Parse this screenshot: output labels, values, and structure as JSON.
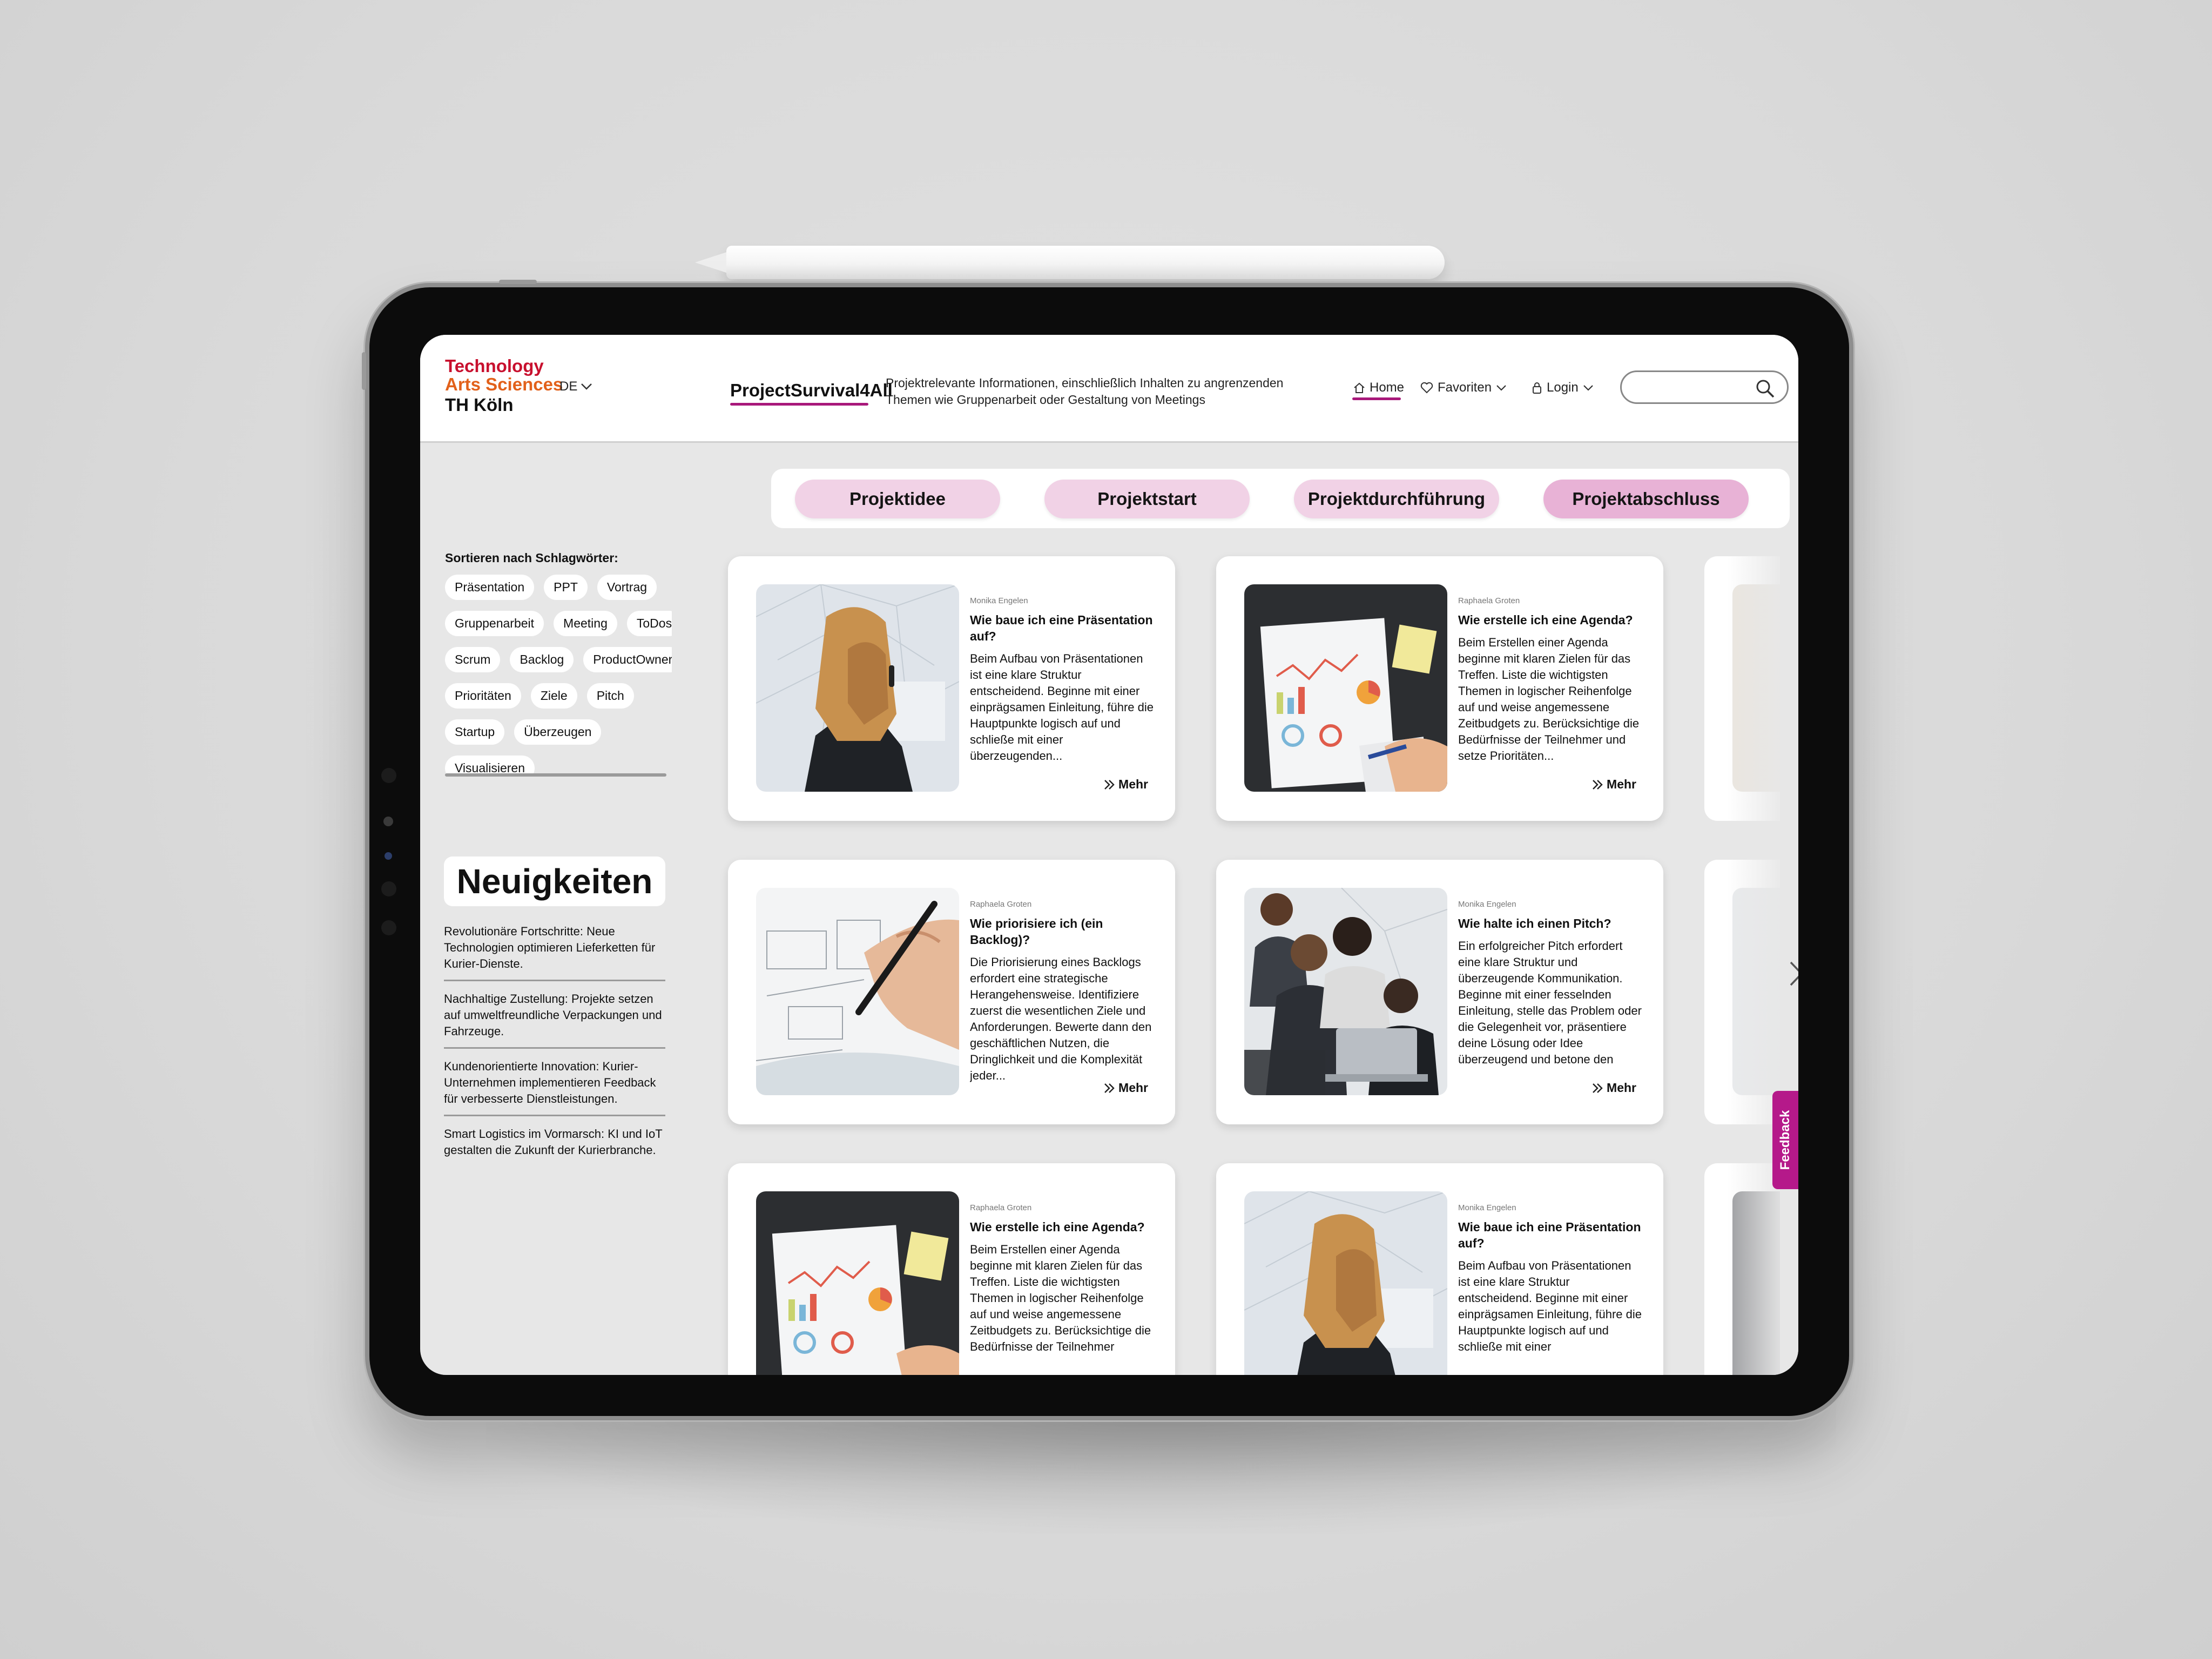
{
  "header": {
    "logo": {
      "line1": "Technology",
      "line2": "Arts Sciences",
      "line3": "TH Köln"
    },
    "language": "DE",
    "brand": "ProjectSurvival4All",
    "tagline": "Projektrelevante Informationen, einschließlich Inhalten zu angrenzenden Themen wie Gruppenarbeit oder Gestaltung von Meetings",
    "nav": {
      "home": "Home",
      "favorites": "Favoriten",
      "login": "Login"
    },
    "search_placeholder": ""
  },
  "phase_tabs": [
    {
      "label": "Projektidee"
    },
    {
      "label": "Projektstart"
    },
    {
      "label": "Projektdurchführung"
    },
    {
      "label": "Projektabschluss",
      "active": true
    }
  ],
  "sidebar": {
    "sort_label": "Sortieren nach Schlagwörter:",
    "tags": [
      "Präsentation",
      "PPT",
      "Vortrag",
      "Gruppenarbeit",
      "Meeting",
      "ToDos",
      "Scrum",
      "Backlog",
      "ProductOwner",
      "Prioritäten",
      "Ziele",
      "Pitch",
      "Startup",
      "Überzeugen",
      "Visualisieren"
    ],
    "news_title": "Neuigkeiten",
    "news": [
      "Revolutionäre Fortschritte: Neue Technologien optimieren Lieferketten für Kurier-Dienste.",
      "Nachhaltige Zustellung: Projekte setzen auf umweltfreundliche Verpackungen und Fahrzeuge.",
      "Kundenorientierte Innovation: Kurier-Unternehmen implementieren Feedback für verbesserte Dienstleistungen.",
      "Smart Logistics im Vormarsch: KI und IoT gestalten die Zukunft der Kurierbranche."
    ]
  },
  "cards": [
    {
      "author": "Monika Engelen",
      "title": "Wie baue ich eine Präsentation auf?",
      "text": "Beim Aufbau von Präsentationen ist eine klare Struktur entscheidend. Beginne mit einer einprägsamen Einleitung, führe die Hauptpunkte logisch auf und schließe mit einer überzeugenden...",
      "more": "Mehr"
    },
    {
      "author": "Raphaela Groten",
      "title": "Wie erstelle ich eine Agenda?",
      "text": "Beim Erstellen einer Agenda beginne mit klaren Zielen für das Treffen. Liste die wichtigsten Themen in logischer Reihenfolge auf und weise angemessene Zeitbudgets zu. Berücksichtige die Bedürfnisse der Teilnehmer und setze Prioritäten...",
      "more": "Mehr"
    },
    {
      "author": "Raphaela Groten",
      "title": "Wie priorisiere ich (ein Backlog)?",
      "text": "Die Priorisierung eines Backlogs erfordert eine strategische Herangehensweise. Identifiziere zuerst die wesentlichen Ziele und Anforderungen. Bewerte dann den geschäftlichen Nutzen, die Dringlichkeit und die Komplexität jeder...",
      "more": "Mehr"
    },
    {
      "author": "Monika Engelen",
      "title": "Wie halte ich einen Pitch?",
      "text": "Ein erfolgreicher Pitch erfordert eine klare Struktur und überzeugende Kommunikation. Beginne mit einer fesselnden Einleitung, stelle das Problem oder die Gelegenheit vor, präsentiere deine Lösung oder Idee überzeugend und betone den Nutzen...",
      "more": "Mehr"
    },
    {
      "author": "Raphaela Groten",
      "title": "Wie erstelle ich eine Agenda?",
      "text": "Beim Erstellen einer Agenda beginne mit klaren Zielen für das Treffen. Liste die wichtigsten Themen in logischer Reihenfolge auf und weise angemessene Zeitbudgets zu. Berücksichtige die Bedürfnisse der Teilnehmer",
      "more": ""
    },
    {
      "author": "Monika Engelen",
      "title": "Wie baue ich eine Präsentation auf?",
      "text": "Beim Aufbau von Präsentationen ist eine klare Struktur entscheidend. Beginne mit einer einprägsamen Einleitung, führe die Hauptpunkte logisch auf und schließe mit einer",
      "more": ""
    }
  ],
  "feedback_label": "Feedback",
  "colors": {
    "accent": "#a8187a",
    "tab": "#f1d2e6",
    "tab_active": "#e8b2d6",
    "feedback": "#b5198a",
    "logo_red": "#c8102e",
    "logo_orange": "#e2611b",
    "logo_magenta": "#b5198a"
  }
}
